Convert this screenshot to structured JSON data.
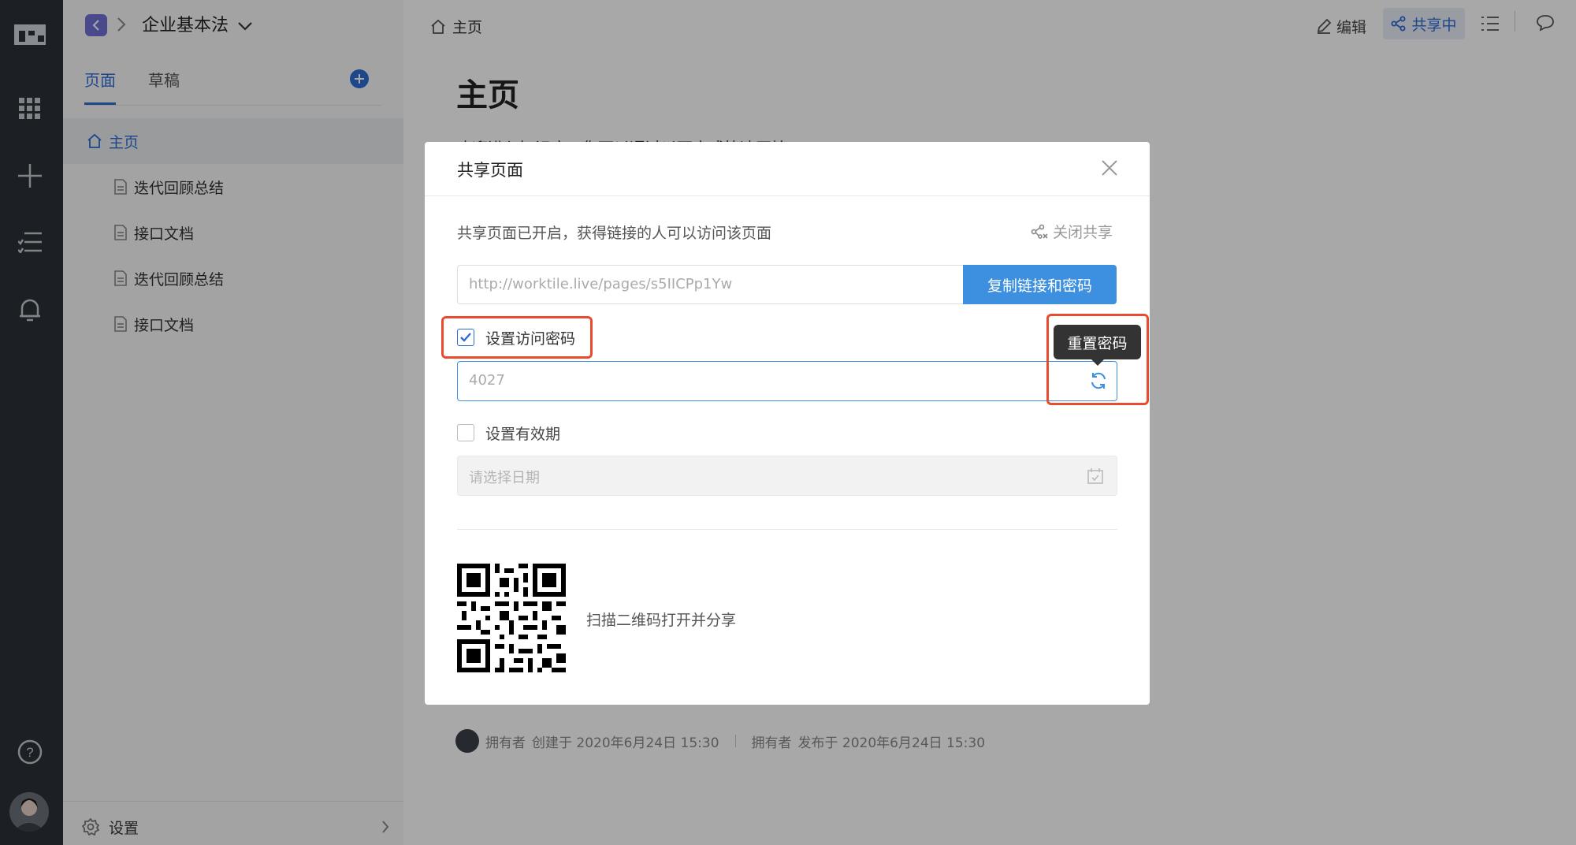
{
  "sidebar": {
    "title": "企业基本法",
    "tabs": [
      "页面",
      "草稿"
    ],
    "items": [
      {
        "label": "主页"
      },
      {
        "label": "迭代回顾总结"
      },
      {
        "label": "接口文档"
      },
      {
        "label": "迭代回顾总结"
      },
      {
        "label": "接口文档"
      }
    ],
    "settings_label": "设置"
  },
  "main": {
    "breadcrumb": "主页",
    "page_title": "主页",
    "intro_text": "欢迎进入知识库，您可以通过以下方式快速开始",
    "edit_label": "编辑",
    "sharing_label": "共享中",
    "meta_owner": "拥有者",
    "meta_created": "创建于 2020年6月24日 15:30",
    "meta_published": "发布于 2020年6月24日 15:30"
  },
  "modal": {
    "title": "共享页面",
    "status_text": "共享页面已开启，获得链接的人可以访问该页面",
    "close_share_label": "关闭共享",
    "link_value": "http://worktile.live/pages/s5IICPp1Yw",
    "copy_button_label": "复制链接和密码",
    "password_checkbox_label": "设置访问密码",
    "password_checked": true,
    "password_value": "4027",
    "tooltip": "重置密码",
    "expiry_checkbox_label": "设置有效期",
    "expiry_checked": false,
    "date_placeholder": "请选择日期",
    "qr_caption": "扫描二维码打开并分享"
  },
  "colors": {
    "accent": "#2d6bd3",
    "primary_button": "#3d8fe0",
    "highlight": "#e84b2f"
  }
}
